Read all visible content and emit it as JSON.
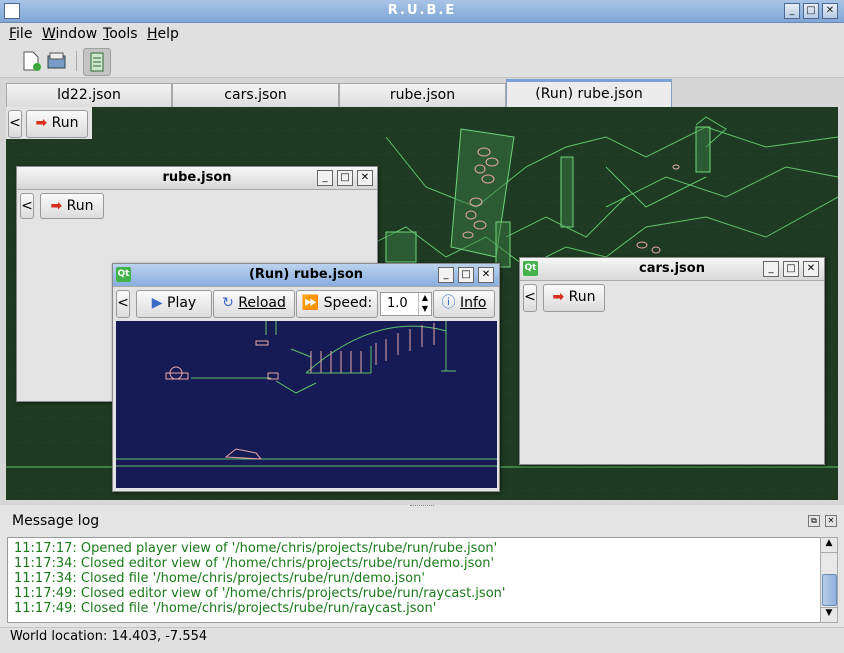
{
  "window": {
    "title": "R.U.B.E"
  },
  "menu": [
    {
      "label": "File",
      "u": "F",
      "rest": "ile"
    },
    {
      "label": "Window",
      "u": "W",
      "rest": "indow"
    },
    {
      "label": "Tools",
      "u": "T",
      "rest": "ools"
    },
    {
      "label": "Help",
      "u": "H",
      "rest": "elp"
    }
  ],
  "toolbar": [
    "new-file-icon",
    "open-icon",
    "player-icon"
  ],
  "tabs": [
    "ld22.json",
    "cars.json",
    "rube.json",
    "(Run) rube.json"
  ],
  "active_tab": 3,
  "canvas": {
    "back": "<",
    "run": "Run",
    "background": "#1e3a22",
    "line_color": "#5fc46a"
  },
  "rube_window": {
    "title": "rube.json",
    "back": "<",
    "run": "Run",
    "qt": "Qt"
  },
  "run_window": {
    "title": "(Run) rube.json",
    "qt": "Qt",
    "back": "<",
    "play": "Play",
    "reload": "Reload",
    "speed_label": "Speed:",
    "speed_value": "1.0",
    "info": "Info",
    "background": "#161a55"
  },
  "cars_window": {
    "title": "cars.json",
    "back": "<",
    "run": "Run",
    "qt": "Qt"
  },
  "log": {
    "title": "Message log",
    "lines": [
      "11:17:17: Opened player view of '/home/chris/projects/rube/run/rube.json'",
      "11:17:34: Closed editor view of '/home/chris/projects/rube/run/demo.json'",
      "11:17:34: Closed file '/home/chris/projects/rube/run/demo.json'",
      "11:17:49: Closed editor view of '/home/chris/projects/rube/run/raycast.json'",
      "11:17:49: Closed file '/home/chris/projects/rube/run/raycast.json'"
    ]
  },
  "status": "World location: 14.403, -7.554"
}
